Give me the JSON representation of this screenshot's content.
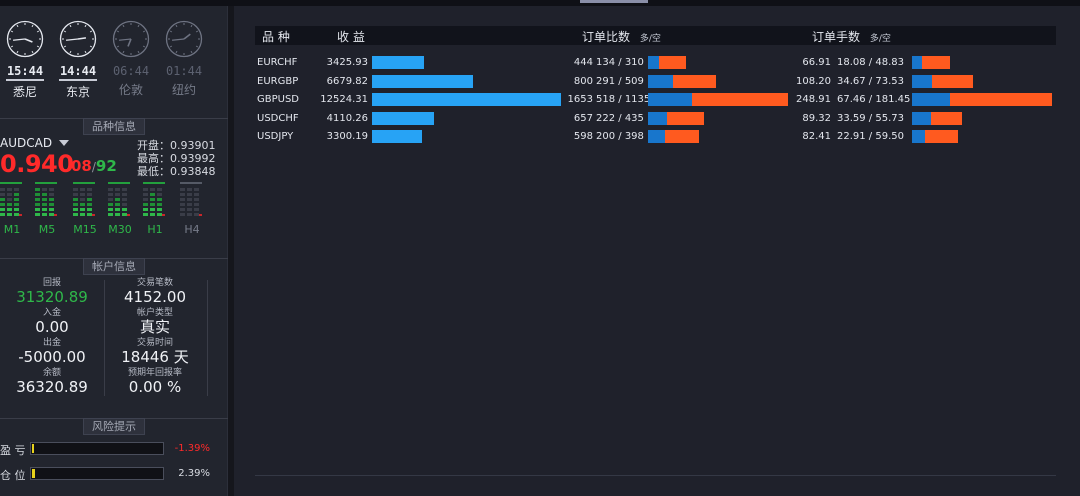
{
  "clocks": [
    {
      "time": "15:44",
      "city": "悉尼",
      "active": true
    },
    {
      "time": "14:44",
      "city": "东京",
      "active": true
    },
    {
      "time": "06:44",
      "city": "伦敦",
      "active": false
    },
    {
      "time": "01:44",
      "city": "纽约",
      "active": false
    }
  ],
  "sections": {
    "symbol_info": "品种信息",
    "account_info": "帐户信息",
    "risk": "风险提示"
  },
  "symbol": {
    "name": "AUDCAD",
    "price_main": "0.940",
    "price_pip_a": "08",
    "price_sep": "/",
    "price_pip_b": "92",
    "open": "开盘：0.93901",
    "high": "最高：0.93992",
    "low": "最低：0.93848",
    "colors": {
      "down": "#ff2a2a",
      "up": "#2fb84a"
    }
  },
  "timeframes": [
    "M1",
    "M5",
    "M15",
    "M30",
    "H1",
    "H4"
  ],
  "account": {
    "left": [
      {
        "key": "回报",
        "value": "31320.89",
        "color": "#2fb84a"
      },
      {
        "key": "入金",
        "value": "0.00"
      },
      {
        "key": "出金",
        "value": "-5000.00"
      },
      {
        "key": "余额",
        "value": "36320.89"
      }
    ],
    "right": [
      {
        "key": "交易笔数",
        "value": "4152.00"
      },
      {
        "key": "帐户类型",
        "value": "真实"
      },
      {
        "key": "交易时间",
        "value": "18446 天"
      },
      {
        "key": "预期年回报率",
        "value": "0.00 %"
      }
    ]
  },
  "risk": [
    {
      "label": "盈 亏",
      "value": "-1.39%",
      "value_color": "#ff2a2a",
      "fill": 0.0139,
      "fill_color": "#e8d21c"
    },
    {
      "label": "仓 位",
      "value": "2.39%",
      "value_color": "#d8dbe2",
      "fill": 0.0239,
      "fill_color": "#e8d21c"
    }
  ],
  "table": {
    "headers": {
      "symbol": "品 种",
      "profit": "收 益",
      "order_ratio": "订单比数",
      "order_ratio_unit": "多/空",
      "lot_ratio": "订单手数",
      "lot_ratio_unit": "多/空"
    },
    "rows": [
      {
        "symbol": "EURCHF",
        "profit": "3425.93",
        "profit_val": 3425.93,
        "orders": "444",
        "orders_ls": "134 / 310",
        "o_long": 134,
        "o_short": 310,
        "lots": "66.91",
        "lots_ls": "18.08 / 48.83",
        "l_long": 18.08,
        "l_short": 48.83
      },
      {
        "symbol": "EURGBP",
        "profit": "6679.82",
        "profit_val": 6679.82,
        "orders": "800",
        "orders_ls": "291 / 509",
        "o_long": 291,
        "o_short": 509,
        "lots": "108.20",
        "lots_ls": "34.67 / 73.53",
        "l_long": 34.67,
        "l_short": 73.53
      },
      {
        "symbol": "GBPUSD",
        "profit": "12524.31",
        "profit_val": 12524.31,
        "orders": "1653",
        "orders_ls": "518 / 1135",
        "o_long": 518,
        "o_short": 1135,
        "lots": "248.91",
        "lots_ls": "67.46 / 181.45",
        "l_long": 67.46,
        "l_short": 181.45
      },
      {
        "symbol": "USDCHF",
        "profit": "4110.26",
        "profit_val": 4110.26,
        "orders": "657",
        "orders_ls": "222 / 435",
        "o_long": 222,
        "o_short": 435,
        "lots": "89.32",
        "lots_ls": "33.59 / 55.73",
        "l_long": 33.59,
        "l_short": 55.73
      },
      {
        "symbol": "USDJPY",
        "profit": "3300.19",
        "profit_val": 3300.19,
        "orders": "598",
        "orders_ls": "200 / 398",
        "o_long": 200,
        "o_short": 398,
        "lots": "82.41",
        "lots_ls": "22.91 / 59.50",
        "l_long": 22.91,
        "l_short": 59.5
      }
    ]
  }
}
